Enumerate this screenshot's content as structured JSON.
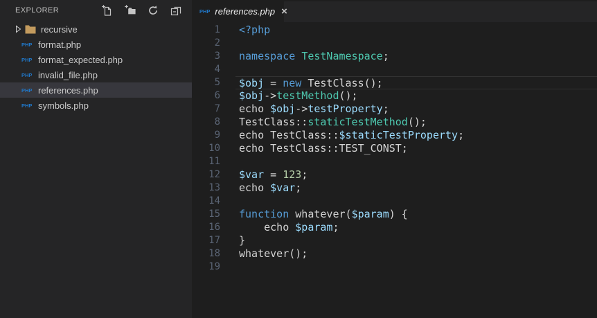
{
  "colors": {
    "editorBg": "#1e1e1e",
    "sidebarBg": "#252526",
    "tabstripBg": "#252526",
    "tabActiveBg": "#1e1e1e",
    "selectionBg": "#37373d",
    "lineNumber": "#5a6474",
    "currentLineBorder": "#323232",
    "kw": "#569cd6",
    "type": "#4ec9b0",
    "varc": "#9cdcfe",
    "num": "#b5cea8",
    "plain": "#d4d4d4",
    "phpIcon": "#2077c8",
    "folderIcon": "#c39b5e",
    "uiText": "#cccccc",
    "titleText": "#bbbbbb",
    "iconColor": "#c5c5c5"
  },
  "explorer": {
    "title": "EXPLORER",
    "file_icon_text": "PHP",
    "actions": [
      {
        "name": "new-file-icon"
      },
      {
        "name": "new-folder-icon"
      },
      {
        "name": "refresh-icon"
      },
      {
        "name": "collapse-all-icon"
      }
    ],
    "items": [
      {
        "kind": "folder",
        "label": "recursive",
        "expanded": false,
        "selected": false
      },
      {
        "kind": "file",
        "label": "format.php",
        "selected": false
      },
      {
        "kind": "file",
        "label": "format_expected.php",
        "selected": false
      },
      {
        "kind": "file",
        "label": "invalid_file.php",
        "selected": false
      },
      {
        "kind": "file",
        "label": "references.php",
        "selected": true
      },
      {
        "kind": "file",
        "label": "symbols.php",
        "selected": false
      }
    ]
  },
  "editor": {
    "tab": {
      "label": "references.php",
      "icon_text": "PHP",
      "close_glyph": "×",
      "preview": true,
      "active": true
    },
    "current_line": 5,
    "lines": [
      {
        "n": 1,
        "tokens": [
          [
            "kw",
            "<?php"
          ]
        ]
      },
      {
        "n": 2,
        "tokens": []
      },
      {
        "n": 3,
        "tokens": [
          [
            "kw",
            "namespace"
          ],
          [
            "plain",
            " "
          ],
          [
            "type",
            "TestNamespace"
          ],
          [
            "plain",
            ";"
          ]
        ]
      },
      {
        "n": 4,
        "tokens": []
      },
      {
        "n": 5,
        "tokens": [
          [
            "var",
            "$obj"
          ],
          [
            "plain",
            " = "
          ],
          [
            "kw",
            "new"
          ],
          [
            "plain",
            " TestClass();"
          ]
        ]
      },
      {
        "n": 6,
        "tokens": [
          [
            "var",
            "$obj"
          ],
          [
            "plain",
            "->"
          ],
          [
            "type",
            "testMethod"
          ],
          [
            "plain",
            "();"
          ]
        ]
      },
      {
        "n": 7,
        "tokens": [
          [
            "plain",
            "echo "
          ],
          [
            "var",
            "$obj"
          ],
          [
            "plain",
            "->"
          ],
          [
            "var",
            "testProperty"
          ],
          [
            "plain",
            ";"
          ]
        ]
      },
      {
        "n": 8,
        "tokens": [
          [
            "plain",
            "TestClass::"
          ],
          [
            "type",
            "staticTestMethod"
          ],
          [
            "plain",
            "();"
          ]
        ]
      },
      {
        "n": 9,
        "tokens": [
          [
            "plain",
            "echo TestClass::"
          ],
          [
            "var",
            "$staticTestProperty"
          ],
          [
            "plain",
            ";"
          ]
        ]
      },
      {
        "n": 10,
        "tokens": [
          [
            "plain",
            "echo TestClass::TEST_CONST;"
          ]
        ]
      },
      {
        "n": 11,
        "tokens": []
      },
      {
        "n": 12,
        "tokens": [
          [
            "var",
            "$var"
          ],
          [
            "plain",
            " = "
          ],
          [
            "num",
            "123"
          ],
          [
            "plain",
            ";"
          ]
        ]
      },
      {
        "n": 13,
        "tokens": [
          [
            "plain",
            "echo "
          ],
          [
            "var",
            "$var"
          ],
          [
            "plain",
            ";"
          ]
        ]
      },
      {
        "n": 14,
        "tokens": []
      },
      {
        "n": 15,
        "tokens": [
          [
            "kw",
            "function"
          ],
          [
            "plain",
            " whatever("
          ],
          [
            "var",
            "$param"
          ],
          [
            "plain",
            ") {"
          ]
        ]
      },
      {
        "n": 16,
        "tokens": [
          [
            "plain",
            "    echo "
          ],
          [
            "var",
            "$param"
          ],
          [
            "plain",
            ";"
          ]
        ]
      },
      {
        "n": 17,
        "tokens": [
          [
            "plain",
            "}"
          ]
        ]
      },
      {
        "n": 18,
        "tokens": [
          [
            "plain",
            "whatever();"
          ]
        ]
      },
      {
        "n": 19,
        "tokens": []
      }
    ]
  }
}
